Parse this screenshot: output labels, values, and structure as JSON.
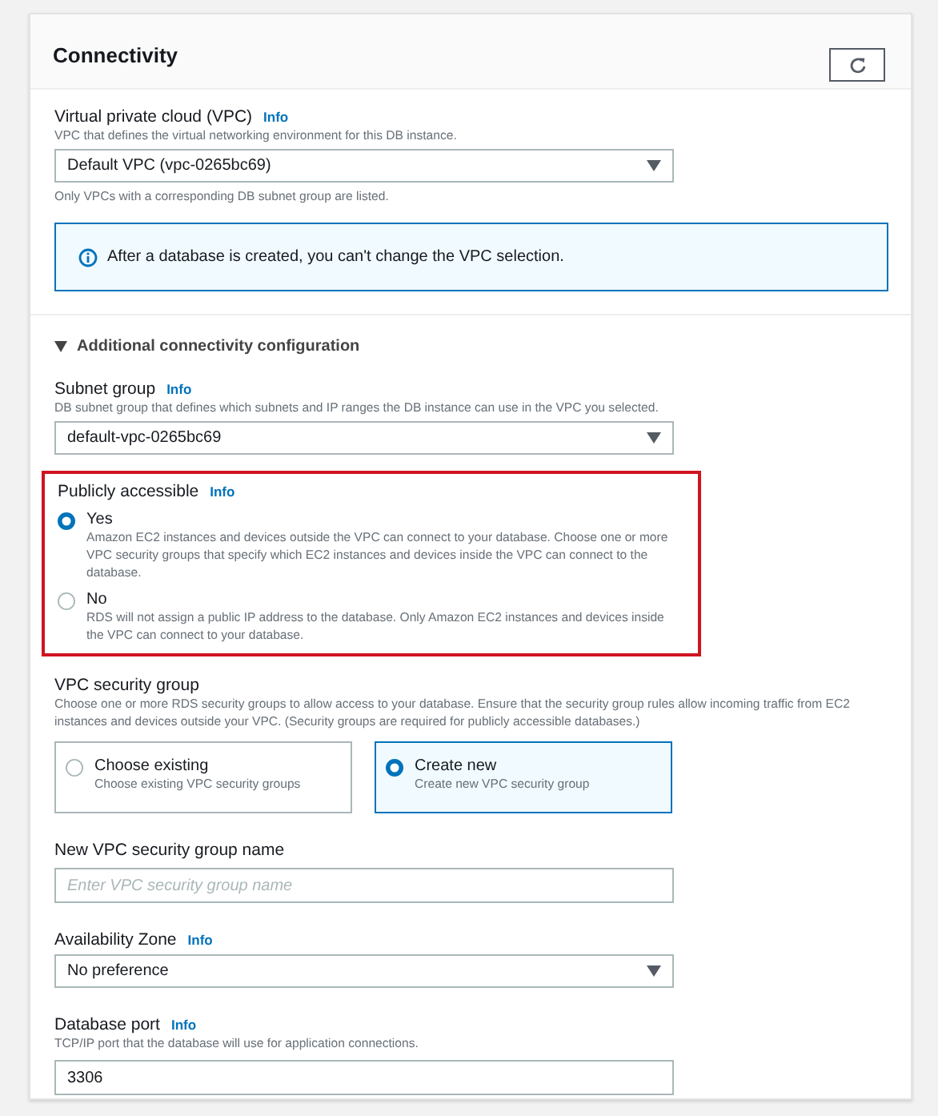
{
  "panel": {
    "title": "Connectivity"
  },
  "vpc": {
    "label": "Virtual private cloud (VPC)",
    "info": "Info",
    "description": "VPC that defines the virtual networking environment for this DB instance.",
    "value": "Default VPC (vpc-0265bc69)",
    "hint": "Only VPCs with a corresponding DB subnet group are listed.",
    "alert": "After a database is created, you can't change the VPC selection."
  },
  "additional": {
    "title": "Additional connectivity configuration",
    "expanded": true,
    "fields": [
      {
        "kind": "select",
        "label": "Subnet group",
        "info": "Info",
        "description": "DB subnet group that defines which subnets and IP ranges the DB instance can use in the VPC you selected.",
        "value": "default-vpc-0265bc69"
      },
      {
        "kind": "radios",
        "label": "Publicly accessible",
        "info": "Info",
        "highlighted": true,
        "options": [
          {
            "label": "Yes",
            "description": "Amazon EC2 instances and devices outside the VPC can connect to your database. Choose one or more VPC security groups that specify which EC2 instances and devices inside the VPC can connect to the database.",
            "selected": true
          },
          {
            "label": "No",
            "description": "RDS will not assign a public IP address to the database. Only Amazon EC2 instances and devices inside the VPC can connect to your database.",
            "selected": false
          }
        ]
      },
      {
        "kind": "tiles",
        "label": "VPC security group",
        "description": "Choose one or more RDS security groups to allow access to your database. Ensure that the security group rules allow incoming traffic from EC2 instances and devices outside your VPC. (Security groups are required for publicly accessible databases.)",
        "options": [
          {
            "label": "Choose existing",
            "description": "Choose existing VPC security groups",
            "selected": false
          },
          {
            "label": "Create new",
            "description": "Create new VPC security group",
            "selected": true
          }
        ]
      },
      {
        "kind": "input",
        "label": "New VPC security group name",
        "placeholder": "Enter VPC security group name"
      },
      {
        "kind": "select",
        "label": "Availability Zone",
        "info": "Info",
        "value": "No preference"
      },
      {
        "kind": "input",
        "label": "Database port",
        "info": "Info",
        "description": "TCP/IP port that the database will use for application connections.",
        "value": "3306"
      }
    ]
  }
}
